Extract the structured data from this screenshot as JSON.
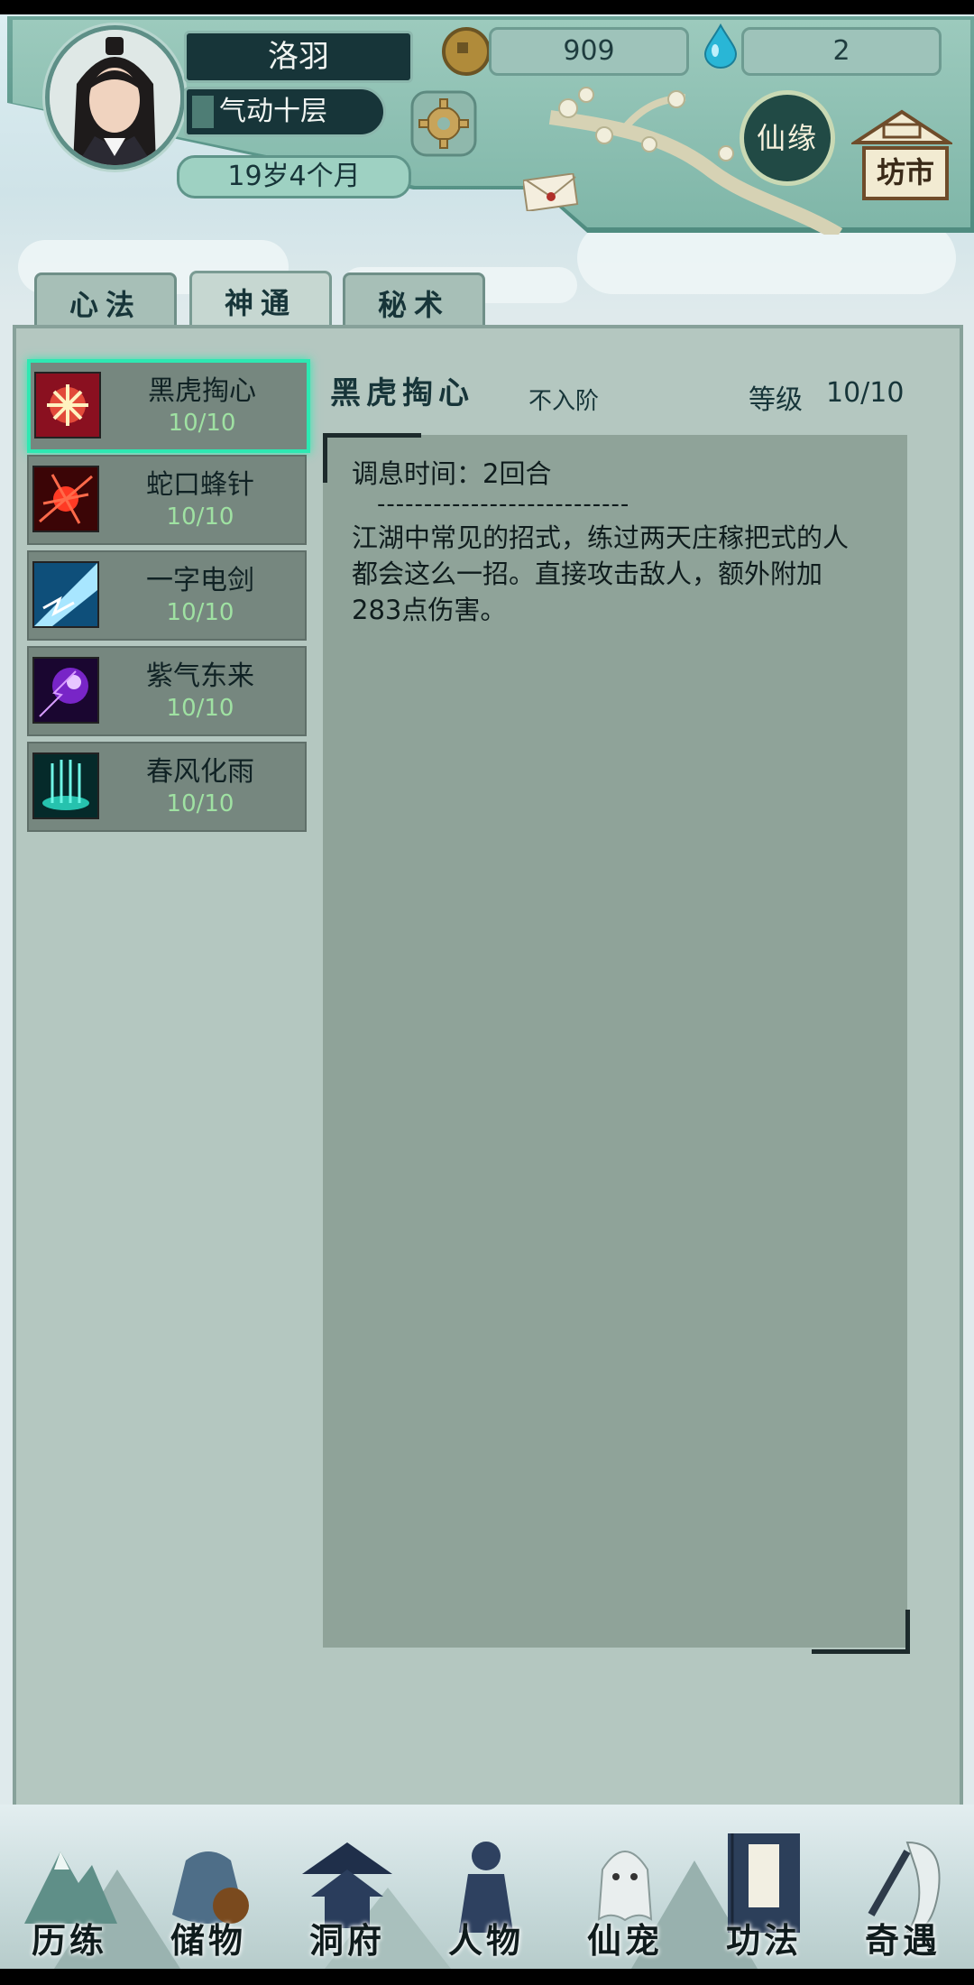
{
  "player": {
    "name": "洛羽",
    "realm": "气动十层",
    "age": "19岁4个月"
  },
  "resources": {
    "coins": "909",
    "spirit_stones": "2"
  },
  "header_buttons": {
    "xianyuan": "仙缘",
    "fangshi": "坊市"
  },
  "tabs": [
    {
      "label": "心法",
      "active": false
    },
    {
      "label": "神通",
      "active": true
    },
    {
      "label": "秘术",
      "active": false
    }
  ],
  "skills": [
    {
      "name": "黑虎掏心",
      "level": "10/10",
      "selected": true,
      "icon": "tiger-claw-icon"
    },
    {
      "name": "蛇口蜂针",
      "level": "10/10",
      "selected": false,
      "icon": "red-sting-icon"
    },
    {
      "name": "一字电剑",
      "level": "10/10",
      "selected": false,
      "icon": "lightning-sword-icon"
    },
    {
      "name": "紫气东来",
      "level": "10/10",
      "selected": false,
      "icon": "purple-qi-icon"
    },
    {
      "name": "春风化雨",
      "level": "10/10",
      "selected": false,
      "icon": "spring-rain-icon"
    }
  ],
  "detail": {
    "title": "黑虎掏心",
    "grade": "不入阶",
    "level_label": "等级",
    "level": "10/10",
    "time_line": "调息时间：2回合",
    "separator": "---------------------------",
    "description": "江湖中常见的招式，练过两天庄稼把式的人都会这么一招。直接攻击敌人，额外附加283点伤害。"
  },
  "nav": [
    {
      "label": "历练",
      "icon": "mountain-icon"
    },
    {
      "label": "储物",
      "icon": "bag-icon"
    },
    {
      "label": "洞府",
      "icon": "pavilion-icon"
    },
    {
      "label": "人物",
      "icon": "person-icon"
    },
    {
      "label": "仙宠",
      "icon": "spirit-pet-icon"
    },
    {
      "label": "功法",
      "icon": "scripture-book-icon"
    },
    {
      "label": "奇遇",
      "icon": "crane-icon"
    }
  ],
  "colors": {
    "selected_border": "#2ee8b2",
    "level_text": "#9fe1a2",
    "panel": "#b4c7c0",
    "detail_bg": "#8fa399"
  }
}
